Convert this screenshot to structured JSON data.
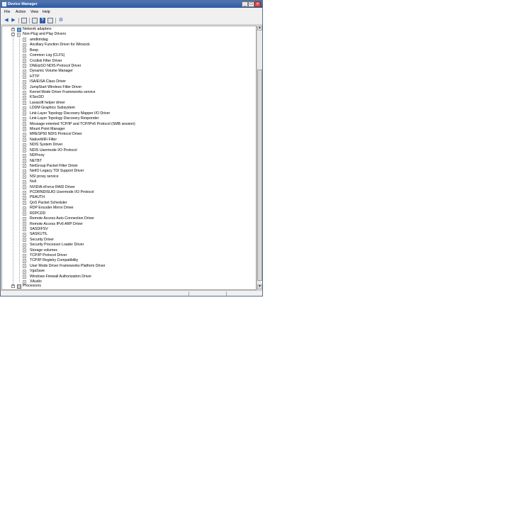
{
  "window": {
    "title": "Device Manager"
  },
  "menu": [
    "File",
    "Action",
    "View",
    "Help"
  ],
  "tree": {
    "top_nodes": [
      {
        "label": "Network adapters",
        "expander": "+",
        "icon": "network-adapter-icon"
      },
      {
        "label": "Non-Plug and Play Drivers",
        "expander": "-",
        "icon": "device-folder-icon"
      }
    ],
    "drivers": [
      "amdkmdag",
      "Ancillary Function Driver for Winsock",
      "Beep",
      "Common Log (CLFS)",
      "Crcdisk Filter Driver",
      "DNE/pSO NDIS Protocol Driver",
      "Dynamic Volume Manager",
      "HTTP",
      "ISA/EISA Class Driver",
      "JumpStart Wireless Filter Driver",
      "Kernel Mode Driver Frameworks service",
      "KSecDD",
      "Lavasoft helper driver",
      "LDDM Graphics Subsystem",
      "Link-Layer Topology Discovery Mapper I/O Driver",
      "Link-Layer Topology Discovery Responder",
      "Message-oriented TCP/IP and TCP/IPv6 Protocol (SMB session)",
      "Mount Point Manager",
      "MRESP50 NDIS Protocol Driver",
      "NativeWiFi Filter",
      "NDIS System Driver",
      "NDIS Usermode I/O Protocol",
      "NDProxy",
      "NETBT",
      "NetGroup Packet Filter Driver",
      "NetIO Legacy TDI Support Driver",
      "NSI proxy service",
      "Null",
      "NVIDIA nForce RAID Driver",
      "PCDRNDISUIO Usermode I/O Protocol",
      "PEAUTH",
      "QoS Packet Scheduler",
      "RDP Encoder Mirror Driver",
      "RDPCDD",
      "Remote Access Auto Connection Driver",
      "Remote Access IPv6 ARP Driver",
      "SASDIFSV",
      "SASKUTIL",
      "Security Driver",
      "Security Processor Loader Driver",
      "Storage volumes",
      "TCP/IP Protocol Driver",
      "TCP/IP Registry Compatibility",
      "User Mode Driver Frameworks Platform Driver",
      "VgaSave",
      "Windows Firewall Authorization Driver",
      "XAudio"
    ],
    "bottom_node": {
      "label": "Processors",
      "expander": "+",
      "icon": "processor-icon"
    }
  },
  "toolbar_icons": [
    "back-icon",
    "forward-icon",
    "up-icon",
    "properties-icon",
    "help-icon",
    "scan-icon",
    "update-driver-icon"
  ]
}
